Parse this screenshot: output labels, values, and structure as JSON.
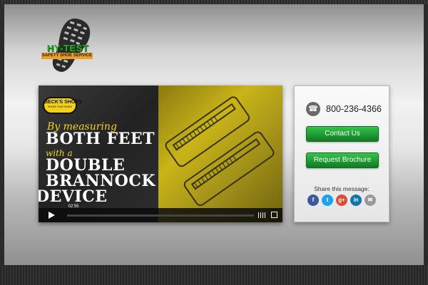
{
  "logo": {
    "title": "HY-TEST",
    "subtitle": "SAFETY SHOE SERVICE",
    "icon": "boot-sole-icon"
  },
  "video": {
    "brand_name": "BECK'S SHOES",
    "brand_tagline": "SHOES THAT WORK",
    "line1": "By measuring",
    "line2": "BOTH FEET",
    "line3": "with a",
    "line4": "DOUBLE",
    "line5": "BRANNOCK",
    "line6": "DEVICE",
    "time": "02:55",
    "progress": 0
  },
  "contact": {
    "phone": "800-236-4366",
    "contact_label": "Contact Us",
    "brochure_label": "Request Brochure",
    "share_label": "Share this message:",
    "social": {
      "facebook": "f",
      "twitter": "t",
      "googleplus": "g+",
      "linkedin": "in",
      "email": "✉"
    }
  },
  "colors": {
    "button_green": "#1e9a33",
    "accent_yellow": "#f3d21a",
    "progress_blue": "#1a9bd8"
  }
}
